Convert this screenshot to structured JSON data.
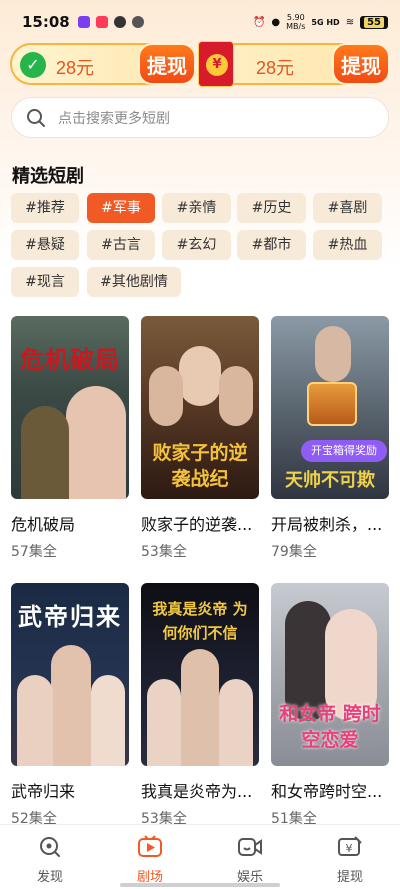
{
  "status_bar": {
    "time": "15:08",
    "speed_value": "5.90",
    "speed_unit": "MB/s",
    "network": "5G HD",
    "battery": "55"
  },
  "rewards": {
    "left_amount": "28元",
    "right_amount": "28元",
    "withdraw_label": "提现",
    "envelope_symbol": "¥"
  },
  "search": {
    "placeholder": "点击搜索更多短剧"
  },
  "section_title": "精选短剧",
  "tags": [
    {
      "label": "#推荐",
      "active": false
    },
    {
      "label": "#军事",
      "active": true
    },
    {
      "label": "#亲情",
      "active": false
    },
    {
      "label": "#历史",
      "active": false
    },
    {
      "label": "#喜剧",
      "active": false
    },
    {
      "label": "#悬疑",
      "active": false
    },
    {
      "label": "#古言",
      "active": false
    },
    {
      "label": "#玄幻",
      "active": false
    },
    {
      "label": "#都市",
      "active": false
    },
    {
      "label": "#热血",
      "active": false
    },
    {
      "label": "#现言",
      "active": false
    },
    {
      "label": "#其他剧情",
      "active": false
    }
  ],
  "dramas": [
    {
      "title": "危机破局",
      "episodes": "57集全",
      "poster_text": "危机破局"
    },
    {
      "title": "败家子的逆袭...",
      "episodes": "53集全",
      "poster_text": "败家子的逆袭战纪"
    },
    {
      "title": "开局被刺杀，...",
      "episodes": "79集全",
      "poster_text": "天帅不可欺",
      "badge": "开宝箱得奖励"
    },
    {
      "title": "武帝归来",
      "episodes": "52集全",
      "poster_text": "武帝归来"
    },
    {
      "title": "我真是炎帝为...",
      "episodes": "53集全",
      "poster_text": "我真是炎帝 为何你们不信"
    },
    {
      "title": "和女帝跨时空...",
      "episodes": "51集全",
      "poster_text": "和女帝 跨时空恋爱"
    }
  ],
  "bottom_nav": [
    {
      "label": "发现",
      "icon": "discover-icon",
      "active": false
    },
    {
      "label": "剧场",
      "icon": "theater-icon",
      "active": true
    },
    {
      "label": "娱乐",
      "icon": "entertainment-icon",
      "active": false
    },
    {
      "label": "提现",
      "icon": "withdraw-icon",
      "active": false
    }
  ],
  "colors": {
    "accent": "#f15a24",
    "tag_bg": "#f8ead9",
    "reward_border": "#f6b53d"
  }
}
